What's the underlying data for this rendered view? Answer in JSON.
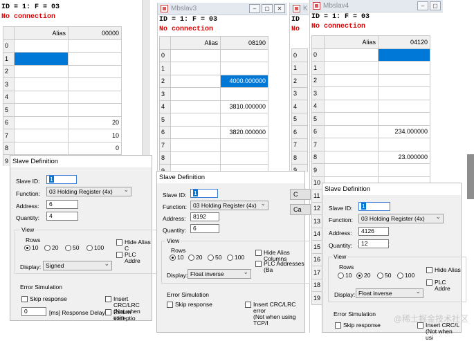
{
  "w1": {
    "status_id": "ID = 1: F = 03",
    "status_conn": "No connection",
    "header_alias": "Alias",
    "header_addr": "00000",
    "rows": [
      {
        "n": "0",
        "v": ""
      },
      {
        "n": "1",
        "v": ""
      },
      {
        "n": "2",
        "v": ""
      },
      {
        "n": "3",
        "v": ""
      },
      {
        "n": "4",
        "v": ""
      },
      {
        "n": "5",
        "v": ""
      },
      {
        "n": "6",
        "v": "20"
      },
      {
        "n": "7",
        "v": "10"
      },
      {
        "n": "8",
        "v": "0"
      },
      {
        "n": "9",
        "v": ""
      }
    ]
  },
  "w2": {
    "title": "Mbslav3",
    "status_id": "ID = 1: F = 03",
    "status_conn": "No connection",
    "header_alias": "Alias",
    "header_addr": "08190",
    "rows": [
      {
        "n": "0",
        "v": ""
      },
      {
        "n": "1",
        "v": ""
      },
      {
        "n": "2",
        "v": "4000.000000"
      },
      {
        "n": "3",
        "v": ""
      },
      {
        "n": "4",
        "v": "3810.000000"
      },
      {
        "n": "5",
        "v": ""
      },
      {
        "n": "6",
        "v": "3820.000000"
      },
      {
        "n": "7",
        "v": ""
      },
      {
        "n": "8",
        "v": ""
      },
      {
        "n": "9",
        "v": ""
      }
    ]
  },
  "w3": {
    "title": "K",
    "status_id": "ID",
    "status_conn": "No",
    "rows": [
      "0",
      "1",
      "2",
      "3",
      "4",
      "5",
      "6",
      "7",
      "8",
      "9"
    ]
  },
  "w4": {
    "title": "Mbslav4",
    "status_id": "ID = 1: F = 03",
    "status_conn": "No connection",
    "header_alias": "Alias",
    "header_addr": "04120",
    "rows": [
      {
        "n": "0",
        "v": ""
      },
      {
        "n": "1",
        "v": ""
      },
      {
        "n": "2",
        "v": ""
      },
      {
        "n": "3",
        "v": ""
      },
      {
        "n": "4",
        "v": ""
      },
      {
        "n": "5",
        "v": ""
      },
      {
        "n": "6",
        "v": "234.000000"
      },
      {
        "n": "7",
        "v": ""
      },
      {
        "n": "8",
        "v": "23.000000"
      },
      {
        "n": "9",
        "v": ""
      },
      {
        "n": "10",
        "v": ""
      },
      {
        "n": "11",
        "v": ""
      },
      {
        "n": "12",
        "v": ""
      },
      {
        "n": "13",
        "v": ""
      },
      {
        "n": "14",
        "v": ""
      },
      {
        "n": "15",
        "v": ""
      },
      {
        "n": "16",
        "v": ""
      },
      {
        "n": "17",
        "v": ""
      },
      {
        "n": "18",
        "v": ""
      },
      {
        "n": "19",
        "v": ""
      }
    ]
  },
  "d1": {
    "title": "Slave Definition",
    "slave_id_label": "Slave ID:",
    "slave_id": "1",
    "function_label": "Function:",
    "function": "03 Holding Register (4x)",
    "address_label": "Address:",
    "address": "6",
    "quantity_label": "Quantity:",
    "quantity": "4",
    "view_label": "View",
    "rows_label": "Rows",
    "r10": "10",
    "r20": "20",
    "r50": "50",
    "r100": "100",
    "hide_alias": "Hide Alias C",
    "plc_addr": "PLC Addre",
    "display_label": "Display:",
    "display": "Signed",
    "err_label": "Error Simulation",
    "skip": "Skip response",
    "crc": "Insert CRC/LRC",
    "crc2": "(Not when usin",
    "delay_val": "0",
    "delay_label": "[ms] Response Delay",
    "ret_exc": "Return exceptio"
  },
  "d2": {
    "title": "Slave Definition",
    "slave_id_label": "Slave ID:",
    "slave_id": "1",
    "function_label": "Function:",
    "function": "03 Holding Register (4x)",
    "address_label": "Address:",
    "address": "8192",
    "quantity_label": "Quantity:",
    "quantity": "6",
    "view_label": "View",
    "rows_label": "Rows",
    "r10": "10",
    "r20": "20",
    "r50": "50",
    "r100": "100",
    "hide_alias": "Hide Alias Columns",
    "plc_addr": "PLC Addresses (Ba",
    "display_label": "Display:",
    "display": "Float inverse",
    "err_label": "Error Simulation",
    "skip": "Skip response",
    "crc": "Insert CRC/LRC error",
    "crc2": "(Not when using TCP/I",
    "ok": "C",
    "cancel": "Ca"
  },
  "d3": {
    "title": "Slave Definition",
    "slave_id_label": "Slave ID:",
    "slave_id": "1",
    "function_label": "Function:",
    "function": "03 Holding Register (4x)",
    "address_label": "Address:",
    "address": "4126",
    "quantity_label": "Quantity:",
    "quantity": "12",
    "view_label": "View",
    "rows_label": "Rows",
    "r10": "10",
    "r20": "20",
    "r50": "50",
    "r100": "100",
    "hide_alias": "Hide Alias",
    "plc_addr": "PLC Addre",
    "display_label": "Display:",
    "display": "Float inverse",
    "err_label": "Error Simulation",
    "skip": "Skip response",
    "crc": "Insert CRC/L",
    "crc2": "(Not when usi"
  },
  "watermark": "@稀土掘金技术社区"
}
